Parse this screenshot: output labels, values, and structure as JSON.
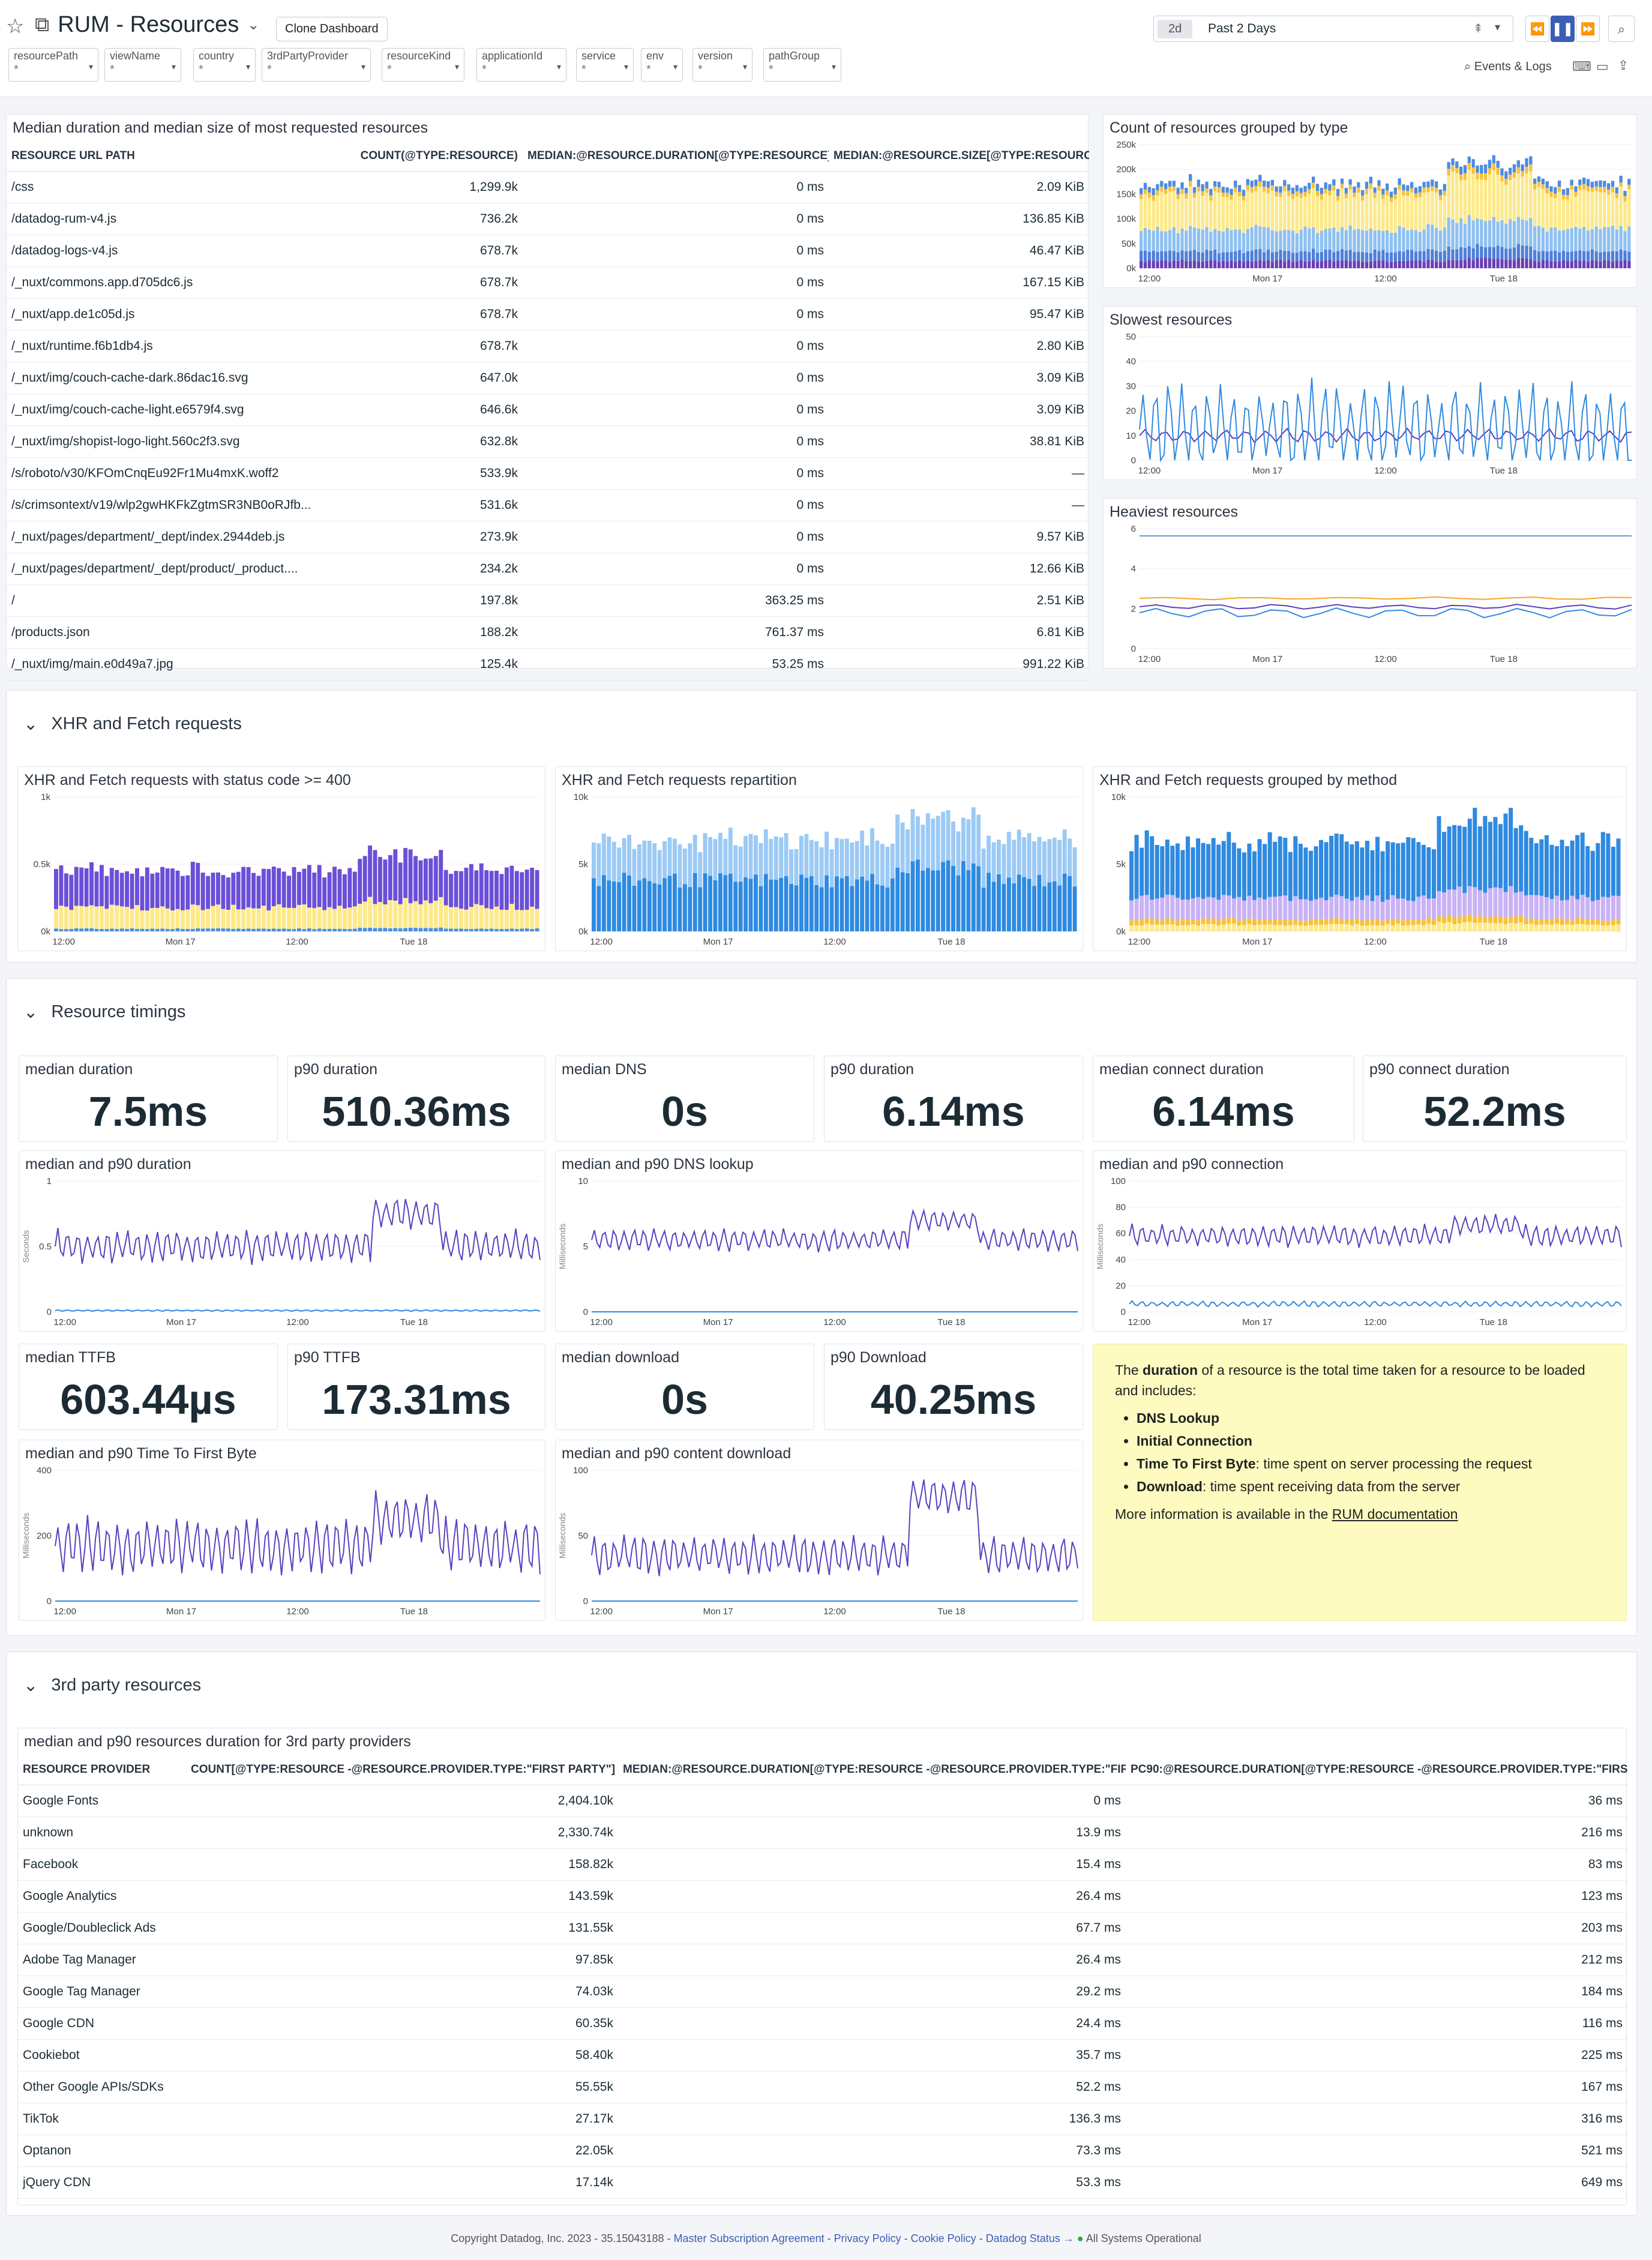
{
  "header": {
    "title": "RUM - Resources",
    "clone_label": "Clone Dashboard",
    "range_badge": "2d",
    "range_label": "Past 2 Days",
    "events_label": "Events & Logs"
  },
  "variables": [
    {
      "key": "resourcePath",
      "val": "*"
    },
    {
      "key": "viewName",
      "val": "*"
    },
    {
      "key": "country",
      "val": "*"
    },
    {
      "key": "3rdPartyProvider",
      "val": "*"
    },
    {
      "key": "resourceKind",
      "val": "*"
    },
    {
      "key": "applicationId",
      "val": "*"
    },
    {
      "key": "service",
      "val": "*"
    },
    {
      "key": "env",
      "val": "*"
    },
    {
      "key": "version",
      "val": "*"
    },
    {
      "key": "pathGroup",
      "val": "*"
    }
  ],
  "resources_table": {
    "title": "Median duration and median size of most requested resources",
    "headers": [
      "RESOURCE URL PATH",
      "COUNT(@TYPE:RESOURCE)",
      "MEDIAN:@RESOURCE.DURATION[@TYPE:RESOURCE]",
      "MEDIAN:@RESOURCE.SIZE[@TYPE:RESOURCE]"
    ],
    "rows": [
      [
        "/css",
        "1,299.9k",
        "0 ms",
        "2.09 KiB"
      ],
      [
        "/datadog-rum-v4.js",
        "736.2k",
        "0 ms",
        "136.85 KiB"
      ],
      [
        "/datadog-logs-v4.js",
        "678.7k",
        "0 ms",
        "46.47 KiB"
      ],
      [
        "/_nuxt/commons.app.d705dc6.js",
        "678.7k",
        "0 ms",
        "167.15 KiB"
      ],
      [
        "/_nuxt/app.de1c05d.js",
        "678.7k",
        "0 ms",
        "95.47 KiB"
      ],
      [
        "/_nuxt/runtime.f6b1db4.js",
        "678.7k",
        "0 ms",
        "2.80 KiB"
      ],
      [
        "/_nuxt/img/couch-cache-dark.86dac16.svg",
        "647.0k",
        "0 ms",
        "3.09 KiB"
      ],
      [
        "/_nuxt/img/couch-cache-light.e6579f4.svg",
        "646.6k",
        "0 ms",
        "3.09 KiB"
      ],
      [
        "/_nuxt/img/shopist-logo-light.560c2f3.svg",
        "632.8k",
        "0 ms",
        "38.81 KiB"
      ],
      [
        "/s/roboto/v30/KFOmCnqEu92Fr1Mu4mxK.woff2",
        "533.9k",
        "0 ms",
        "—"
      ],
      [
        "/s/crimsontext/v19/wlp2gwHKFkZgtmSR3NB0oRJfb...",
        "531.6k",
        "0 ms",
        "—"
      ],
      [
        "/_nuxt/pages/department/_dept/index.2944deb.js",
        "273.9k",
        "0 ms",
        "9.57 KiB"
      ],
      [
        "/_nuxt/pages/department/_dept/product/_product....",
        "234.2k",
        "0 ms",
        "12.66 KiB"
      ],
      [
        "/",
        "197.8k",
        "363.25 ms",
        "2.51 KiB"
      ],
      [
        "/products.json",
        "188.2k",
        "761.37 ms",
        "6.81 KiB"
      ],
      [
        "/_nuxt/img/main.e0d49a7.jpg",
        "125.4k",
        "53.25 ms",
        "991.22 KiB"
      ]
    ]
  },
  "side_charts": [
    {
      "title": "Count of resources grouped by type",
      "yticks": [
        "250k",
        "200k",
        "150k",
        "100k",
        "50k",
        "0k"
      ]
    },
    {
      "title": "Slowest resources",
      "yticks": [
        "50",
        "40",
        "30",
        "20",
        "10",
        "0"
      ]
    },
    {
      "title": "Heaviest resources",
      "yticks": [
        "6",
        "4",
        "2",
        "0"
      ]
    }
  ],
  "xticks": [
    "12:00",
    "Mon 17",
    "12:00",
    "Tue 18"
  ],
  "groups": {
    "xhr": "XHR and Fetch requests",
    "timings": "Resource timings",
    "third": "3rd party resources"
  },
  "xhr_charts": [
    {
      "title": "XHR and Fetch requests with status code >= 400",
      "yticks": [
        "1k",
        "0.5k",
        "0k"
      ]
    },
    {
      "title": "XHR and Fetch requests repartition",
      "yticks": [
        "10k",
        "5k",
        "0k"
      ]
    },
    {
      "title": "XHR and Fetch requests grouped by method",
      "yticks": [
        "10k",
        "5k",
        "0k"
      ]
    }
  ],
  "query_values": [
    {
      "label": "median duration",
      "value": "7.5ms"
    },
    {
      "label": "p90 duration",
      "value": "510.36ms"
    },
    {
      "label": "median DNS",
      "value": "0s"
    },
    {
      "label": "p90 duration",
      "value": "6.14ms"
    },
    {
      "label": "median connect duration",
      "value": "6.14ms"
    },
    {
      "label": "p90 connect duration",
      "value": "52.2ms"
    },
    {
      "label": "median TTFB",
      "value": "603.44µs"
    },
    {
      "label": "p90 TTFB",
      "value": "173.31ms"
    },
    {
      "label": "median download",
      "value": "0s"
    },
    {
      "label": "p90 Download",
      "value": "40.25ms"
    }
  ],
  "timing_charts": [
    {
      "title": "median and p90 duration",
      "unit": "Seconds",
      "yticks": [
        "1",
        "0.5",
        "0"
      ]
    },
    {
      "title": "median and p90 DNS lookup",
      "unit": "Milliseconds",
      "yticks": [
        "10",
        "5",
        "0"
      ]
    },
    {
      "title": "median and p90 connection",
      "unit": "Milliseconds",
      "yticks": [
        "100",
        "80",
        "60",
        "40",
        "20",
        "0"
      ]
    },
    {
      "title": "median and p90 Time To First Byte",
      "unit": "Milliseconds",
      "yticks": [
        "400",
        "200",
        "0"
      ]
    },
    {
      "title": "median and p90 content download",
      "unit": "Milliseconds",
      "yticks": [
        "100",
        "50",
        "0"
      ]
    }
  ],
  "note": {
    "p1a": "The ",
    "p1b": "duration",
    "p1c": " of a resource is the total time taken for a resource to be loaded and includes:",
    "items": [
      {
        "b": "DNS Lookup",
        "t": ""
      },
      {
        "b": "Initial Connection",
        "t": ""
      },
      {
        "b": "Time To First Byte",
        "t": ": time spent on server processing the request"
      },
      {
        "b": "Download",
        "t": ": time spent receiving data from the server"
      }
    ],
    "p2a": "More information is available in the ",
    "p2link": "RUM documentation"
  },
  "third_table": {
    "title": "median and p90 resources duration for 3rd party providers",
    "headers": [
      "RESOURCE PROVIDER",
      "COUNT[@TYPE:RESOURCE -@RESOURCE.PROVIDER.TYPE:\"FIRST PARTY\"]",
      "MEDIAN:@RESOURCE.DURATION[@TYPE:RESOURCE -@RESOURCE.PROVIDER.TYPE:\"FIRS...",
      "PC90:@RESOURCE.DURATION[@TYPE:RESOURCE -@RESOURCE.PROVIDER.TYPE:\"FIRST P..."
    ],
    "rows": [
      [
        "Google Fonts",
        "2,404.10k",
        "0 ms",
        "36 ms"
      ],
      [
        "unknown",
        "2,330.74k",
        "13.9 ms",
        "216 ms"
      ],
      [
        "Facebook",
        "158.82k",
        "15.4 ms",
        "83 ms"
      ],
      [
        "Google Analytics",
        "143.59k",
        "26.4 ms",
        "123 ms"
      ],
      [
        "Google/Doubleclick Ads",
        "131.55k",
        "67.7 ms",
        "203 ms"
      ],
      [
        "Adobe Tag Manager",
        "97.85k",
        "26.4 ms",
        "212 ms"
      ],
      [
        "Google Tag Manager",
        "74.03k",
        "29.2 ms",
        "184 ms"
      ],
      [
        "Google CDN",
        "60.35k",
        "24.4 ms",
        "116 ms"
      ],
      [
        "Cookiebot",
        "58.40k",
        "35.7 ms",
        "225 ms"
      ],
      [
        "Other Google APIs/SDKs",
        "55.55k",
        "52.2 ms",
        "167 ms"
      ],
      [
        "TikTok",
        "27.17k",
        "136.3 ms",
        "316 ms"
      ],
      [
        "Optanon",
        "22.05k",
        "73.3 ms",
        "521 ms"
      ],
      [
        "jQuery CDN",
        "17.14k",
        "53.3 ms",
        "649 ms"
      ]
    ]
  },
  "footer": {
    "copy": "Copyright Datadog, Inc. 2023 - 35.15043188 - ",
    "l1": "Master Subscription Agreement",
    "l2": "Privacy Policy",
    "l3": "Cookie Policy",
    "l4": "Datadog Status →",
    "status": "All Systems Operational"
  }
}
